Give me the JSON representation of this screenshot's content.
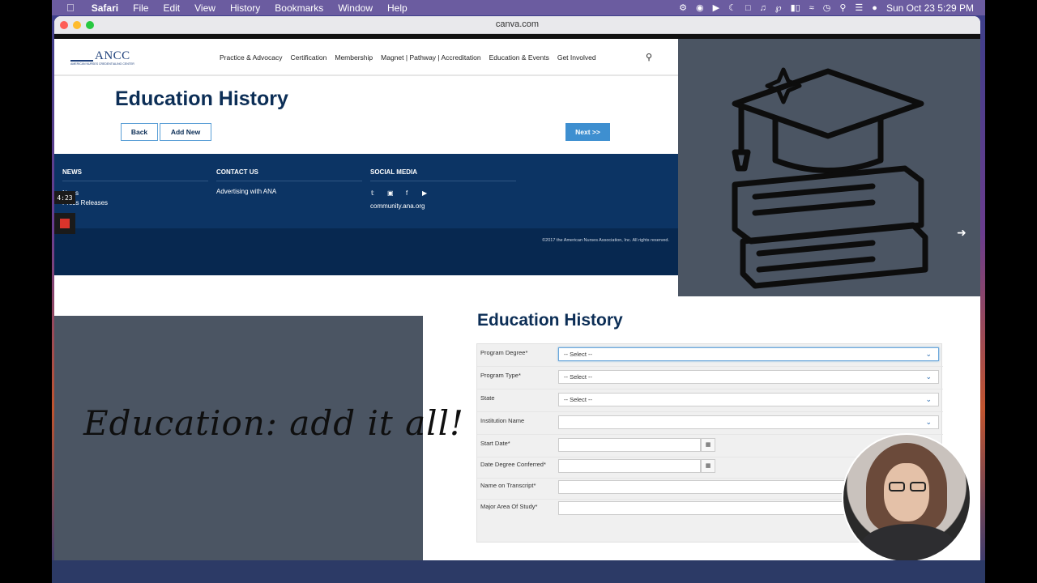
{
  "menubar": {
    "apple": "",
    "app": "Safari",
    "items": [
      "File",
      "Edit",
      "View",
      "History",
      "Bookmarks",
      "Window",
      "Help"
    ],
    "clock": "Sun Oct 23  5:29 PM"
  },
  "browser": {
    "url": "canva.com"
  },
  "site": {
    "logo_text": "ANCC",
    "logo_sub": "AMERICAN NURSES CREDENTIALING CENTER",
    "nav": [
      "Practice & Advocacy",
      "Certification",
      "Membership",
      "Magnet | Pathway | Accreditation",
      "Education & Events",
      "Get Involved"
    ],
    "page_title": "Education History",
    "back_label": "Back",
    "add_new_label": "Add New",
    "next_label": "Next >>",
    "footer": {
      "news_heading": "NEWS",
      "news_link1": "News",
      "news_link2": "Press Releases",
      "contact_heading": "CONTACT US",
      "contact_link": "Advertising with ANA",
      "social_heading": "SOCIAL MEDIA",
      "social_link": "community.ana.org",
      "copyright": "©2017 the American Nurses Association, Inc. All rights reserved."
    }
  },
  "recorder": {
    "time": "4:23"
  },
  "slide": {
    "script_text": "Education: add it all!"
  },
  "form": {
    "title": "Education History",
    "fields": [
      {
        "label": "Program Degree*",
        "value": "-- Select --"
      },
      {
        "label": "Program Type*",
        "value": "-- Select --"
      },
      {
        "label": "State",
        "value": "-- Select --"
      },
      {
        "label": "Institution Name",
        "value": ""
      },
      {
        "label": "Start Date*",
        "value": ""
      },
      {
        "label": "Date Degree Conferred*",
        "value": ""
      },
      {
        "label": "Name on Transcript*",
        "value": ""
      },
      {
        "label": "Major Area Of Study*",
        "value": ""
      }
    ]
  },
  "colors": {
    "navy": "#0c2e56",
    "footer_blue": "#0c3464",
    "accent_blue": "#3e8fd0",
    "panel_gray": "#4b5563"
  }
}
